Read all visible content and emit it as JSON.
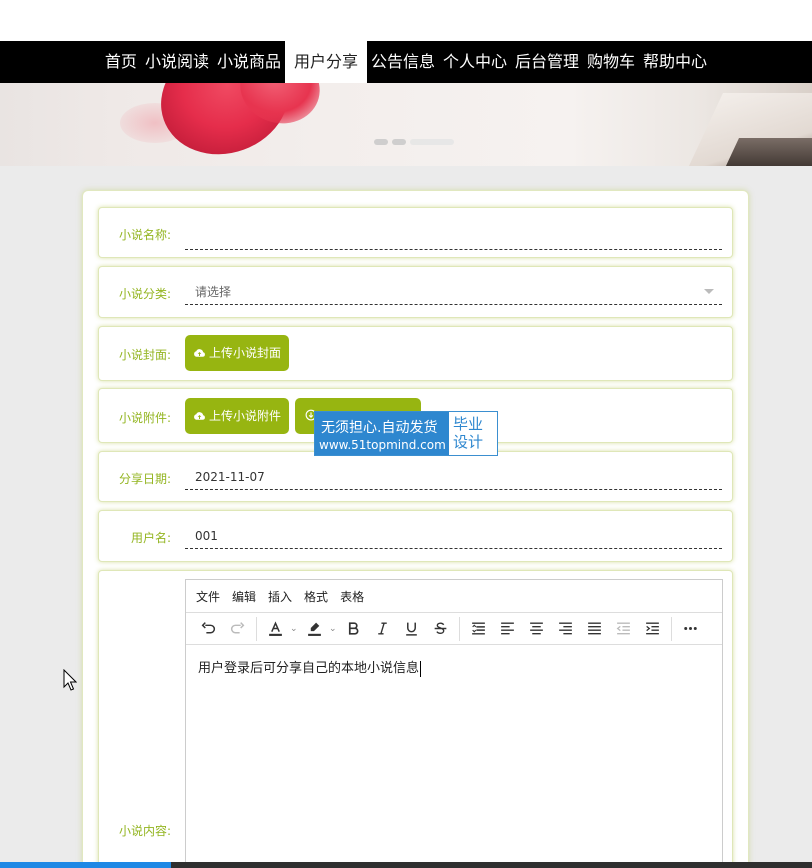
{
  "nav": {
    "items": [
      {
        "label": "首页"
      },
      {
        "label": "小说阅读"
      },
      {
        "label": "小说商品"
      },
      {
        "label": "用户分享",
        "active": true
      },
      {
        "label": "公告信息"
      },
      {
        "label": "个人中心"
      },
      {
        "label": "后台管理"
      },
      {
        "label": "购物车"
      },
      {
        "label": "帮助中心"
      }
    ]
  },
  "banner": {
    "active_slide": 3,
    "slide_count": 3
  },
  "form": {
    "name_label": "小说名称:",
    "name_value": "",
    "category_label": "小说分类:",
    "category_placeholder": "请选择",
    "cover_label": "小说封面:",
    "cover_button": "上传小说封面",
    "attachment_label": "小说附件:",
    "attachment_button": "上传小说附件",
    "date_label": "分享日期:",
    "date_value": "2021-11-07",
    "username_label": "用户名:",
    "username_value": "001",
    "content_label": "小说内容:"
  },
  "editor": {
    "menus": [
      "文件",
      "编辑",
      "插入",
      "格式",
      "表格"
    ],
    "toolbar_icons": [
      "undo-icon",
      "redo-icon",
      "text-color-icon",
      "highlight-color-icon",
      "bold-icon",
      "italic-icon",
      "underline-icon",
      "strikethrough-icon",
      "line-height-icon",
      "align-left-icon",
      "align-center-icon",
      "align-right-icon",
      "align-justify-icon",
      "outdent-icon",
      "indent-icon",
      "more-icon"
    ],
    "content": "用户登录后可分享自己的本地小说信息"
  },
  "watermark": {
    "line1": "无须担心.自动发货",
    "line2": "www.51topmind.com",
    "right": "毕业设计"
  },
  "colors": {
    "accent": "#97b511",
    "label": "#93b520",
    "nav_bg": "#000000",
    "watermark_blue": "#2e87cf"
  },
  "page_progress": 0.21
}
